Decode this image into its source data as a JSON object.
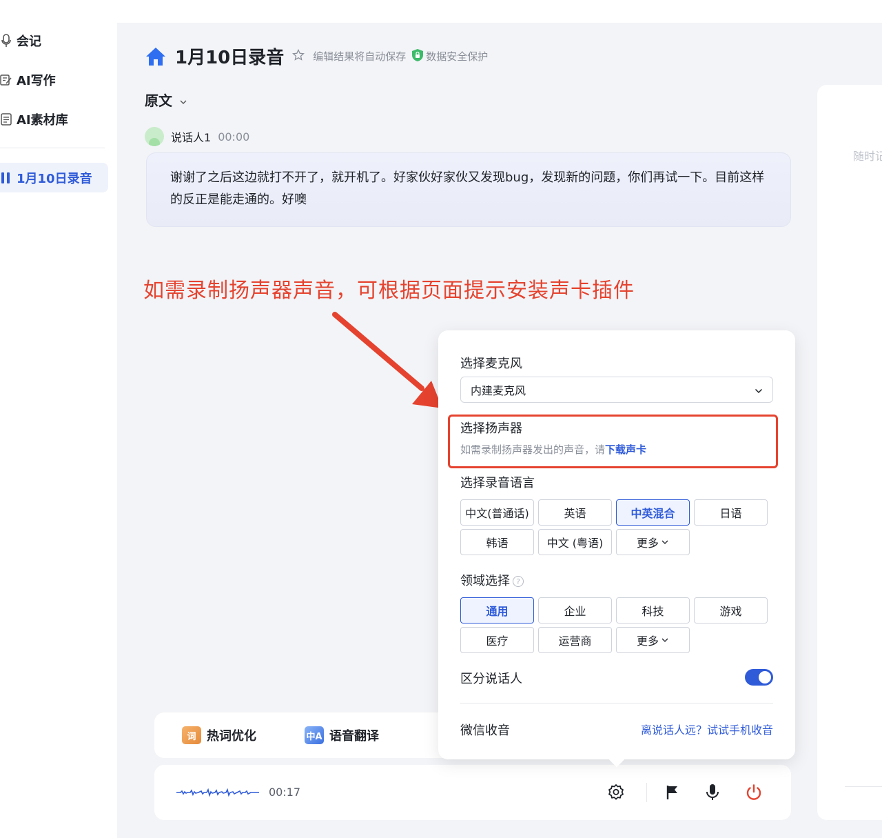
{
  "sidebar": {
    "items": [
      {
        "label": "会记",
        "icon": "microphone-icon"
      },
      {
        "label": "AI写作",
        "icon": "edit-icon"
      },
      {
        "label": "AI素材库",
        "icon": "library-icon"
      }
    ],
    "active_recording": "1月10日录音"
  },
  "header": {
    "title": "1月10日录音",
    "autosave_text": "编辑结果将自动保存",
    "security_text": "数据安全保护"
  },
  "section": {
    "label": "原文"
  },
  "transcript": {
    "speaker": "说话人1",
    "time": "00:00",
    "text": "谢谢了之后这边就打不开了，就开机了。好家伙好家伙又发现bug，发现新的问题，你们再试一下。目前这样的反正是能走通的。好噢"
  },
  "annotation": {
    "text": "如需录制扬声器声音，可根据页面提示安装声卡插件",
    "color": "#e5432f"
  },
  "right_panel": {
    "hint": "随时记"
  },
  "features": {
    "hotword_label": "热词优化",
    "hotword_icon_text": "词",
    "translate_label": "语音翻译",
    "translate_icon_text": "中A"
  },
  "control_bar": {
    "elapsed": "00:17"
  },
  "popover": {
    "mic_label": "选择麦克风",
    "mic_value": "内建麦克风",
    "speaker_label": "选择扬声器",
    "speaker_hint": "如需录制扬声器发出的声音，请",
    "speaker_link": "下载声卡",
    "language_label": "选择录音语言",
    "languages": [
      "中文(普通话)",
      "英语",
      "中英混合",
      "日语",
      "韩语",
      "中文 (粤语)",
      "更多"
    ],
    "language_selected": "中英混合",
    "domain_label": "领域选择",
    "domains": [
      "通用",
      "企业",
      "科技",
      "游戏",
      "医疗",
      "运营商",
      "更多"
    ],
    "domain_selected": "通用",
    "diarization_label": "区分说话人",
    "diarization_on": true,
    "wechat_label": "微信收音",
    "wechat_link": "离说话人远？试试手机收音"
  },
  "colors": {
    "accent": "#2f5bd9",
    "annotation_red": "#e5432f"
  }
}
